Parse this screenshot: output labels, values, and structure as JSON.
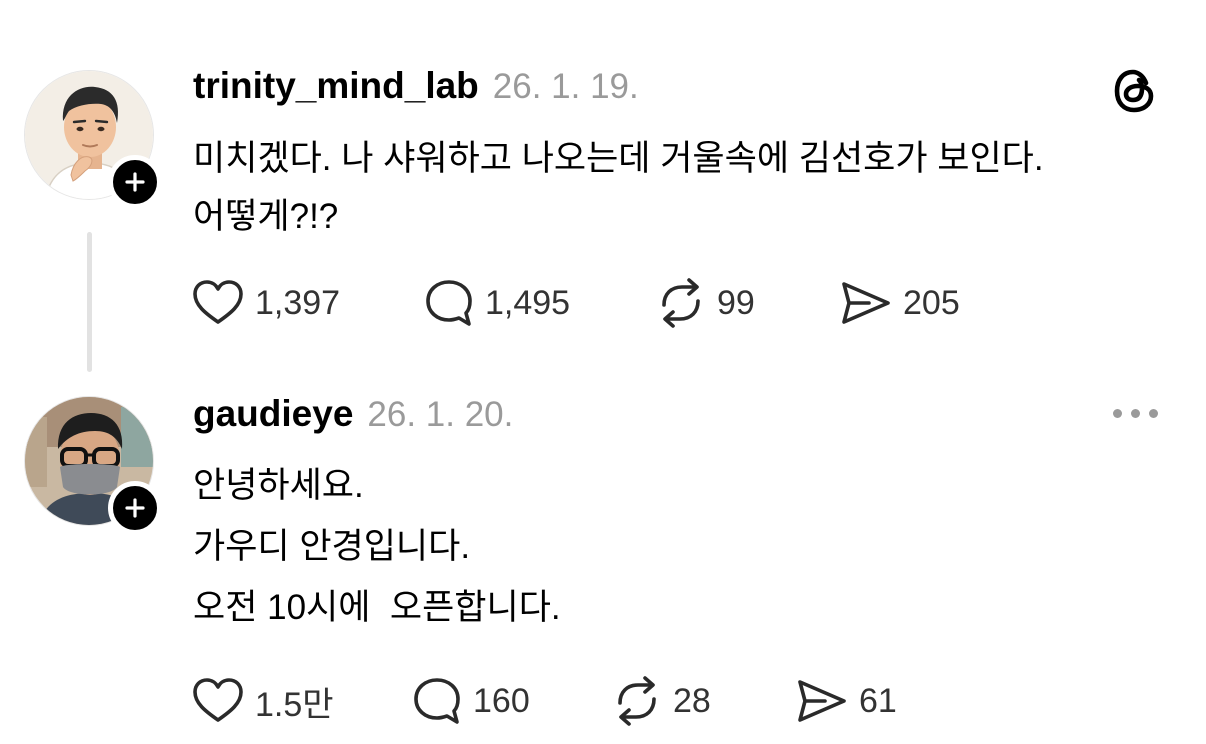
{
  "posts": [
    {
      "username": "trinity_mind_lab",
      "date": "26. 1. 19.",
      "text": "미치겠다. 나 샤워하고 나오는데 거울속에 김선호가 보인다.\n어떻게?!?",
      "stats": {
        "likes": "1,397",
        "replies": "1,495",
        "reposts": "99",
        "shares": "205"
      },
      "corner_icon": "threads-logo-icon"
    },
    {
      "username": "gaudieye",
      "date": "26. 1. 20.",
      "text": "안녕하세요.\n가우디 안경입니다.\n오전 10시에  오픈합니다.",
      "stats": {
        "likes": "1.5만",
        "replies": "160",
        "reposts": "28",
        "shares": "61"
      },
      "corner_icon": "more-icon"
    }
  ],
  "icons": {
    "like": "heart-icon",
    "reply": "speech-bubble-icon",
    "repost": "repost-arrows-icon",
    "share": "paper-plane-icon",
    "follow": "plus-icon"
  },
  "colors": {
    "text": "#000000",
    "muted": "#9a9a9a",
    "thread_line": "#e2e2e2",
    "badge": "#000000"
  }
}
